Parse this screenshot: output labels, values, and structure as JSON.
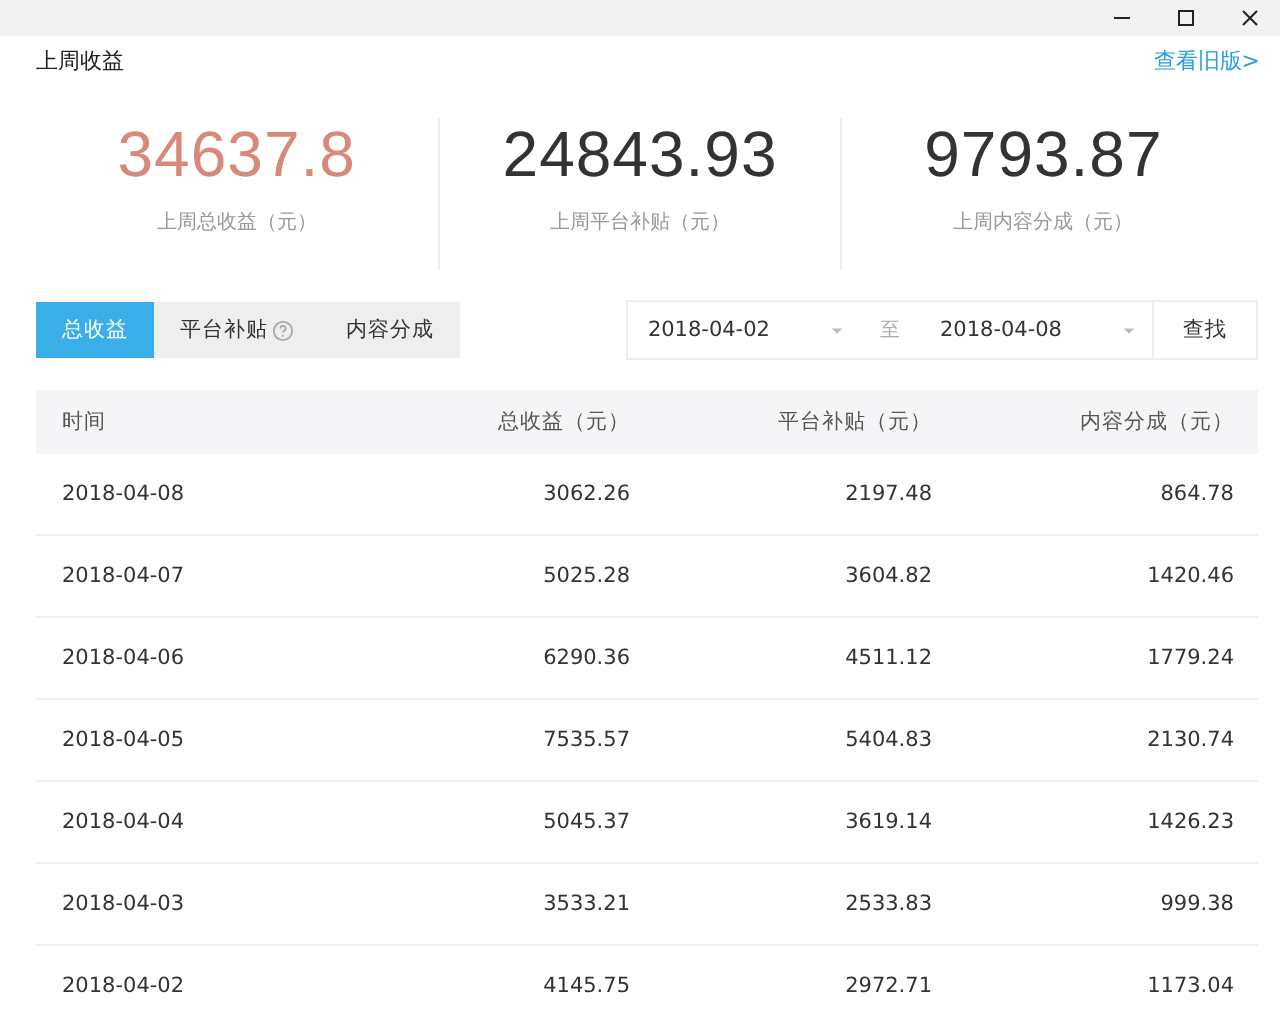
{
  "header": {
    "title": "上周收益",
    "link": "查看旧版>"
  },
  "stats": [
    {
      "value": "34637.8",
      "label": "上周总收益（元）",
      "highlight": true
    },
    {
      "value": "24843.93",
      "label": "上周平台补贴（元）",
      "highlight": false
    },
    {
      "value": "9793.87",
      "label": "上周内容分成（元）",
      "highlight": false
    }
  ],
  "tabs": [
    {
      "label": "总收益",
      "selected": true,
      "help": false
    },
    {
      "label": "平台补贴",
      "selected": false,
      "help": true
    },
    {
      "label": "内容分成",
      "selected": false,
      "help": false
    }
  ],
  "date_range": {
    "start": "2018-04-02",
    "separator": "至",
    "end": "2018-04-08",
    "button": "查找"
  },
  "table": {
    "columns": [
      "时间",
      "总收益（元）",
      "平台补贴（元）",
      "内容分成（元）"
    ],
    "rows": [
      [
        "2018-04-08",
        "3062.26",
        "2197.48",
        "864.78"
      ],
      [
        "2018-04-07",
        "5025.28",
        "3604.82",
        "1420.46"
      ],
      [
        "2018-04-06",
        "6290.36",
        "4511.12",
        "1779.24"
      ],
      [
        "2018-04-05",
        "7535.57",
        "5404.83",
        "2130.74"
      ],
      [
        "2018-04-04",
        "5045.37",
        "3619.14",
        "1426.23"
      ],
      [
        "2018-04-03",
        "3533.21",
        "2533.83",
        "999.38"
      ],
      [
        "2018-04-02",
        "4145.75",
        "2972.71",
        "1173.04"
      ]
    ]
  }
}
